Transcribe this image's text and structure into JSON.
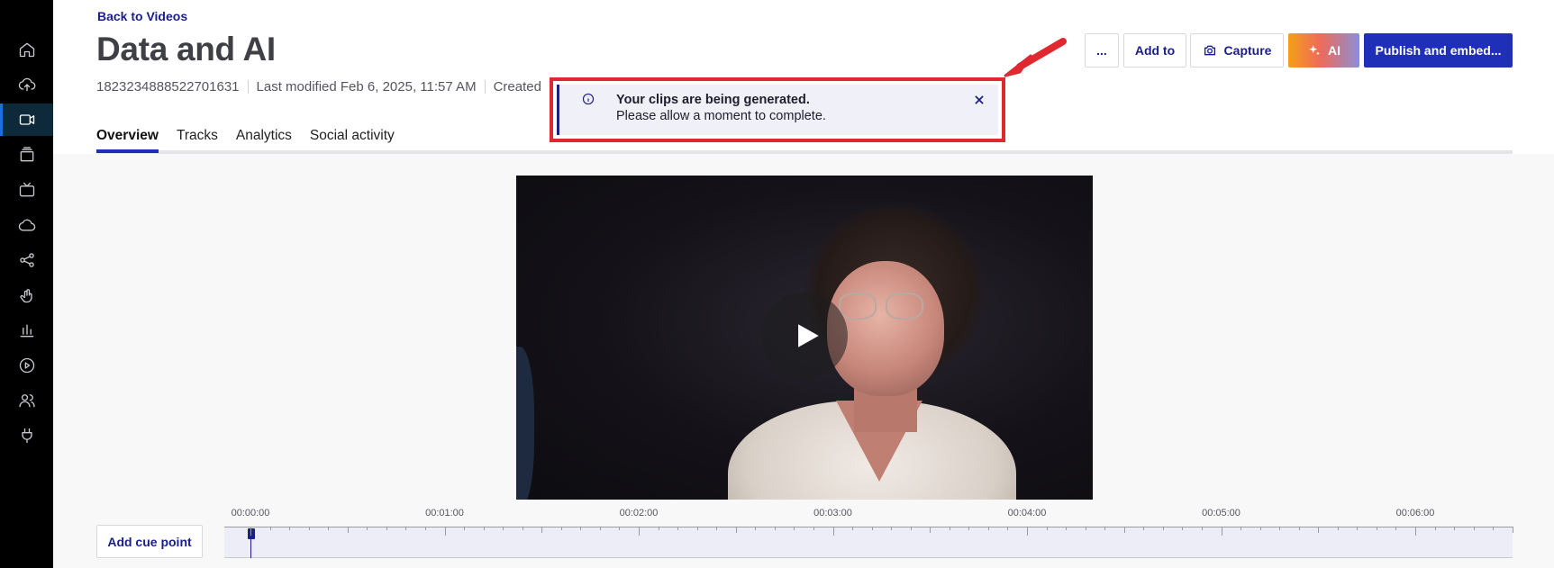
{
  "sidebar": {
    "items": [
      {
        "icon": "home-icon",
        "key": "home"
      },
      {
        "icon": "upload-cloud-icon",
        "key": "upload"
      },
      {
        "icon": "video-camera-icon",
        "key": "videos",
        "active": true
      },
      {
        "icon": "folders-icon",
        "key": "folders"
      },
      {
        "icon": "tv-icon",
        "key": "channels"
      },
      {
        "icon": "cloud-icon",
        "key": "cloud"
      },
      {
        "icon": "share-icon",
        "key": "share"
      },
      {
        "icon": "hand-icon",
        "key": "engage"
      },
      {
        "icon": "bar-chart-icon",
        "key": "analytics"
      },
      {
        "icon": "play-circle-icon",
        "key": "players"
      },
      {
        "icon": "users-icon",
        "key": "users"
      },
      {
        "icon": "plug-icon",
        "key": "integrations"
      }
    ]
  },
  "header": {
    "back_link": "Back to Videos",
    "title": "Data and AI",
    "video_id": "1823234888522701631",
    "last_modified": "Last modified Feb 6, 2025, 11:57 AM",
    "created_truncated": "Created"
  },
  "tabs": [
    "Overview",
    "Tracks",
    "Analytics",
    "Social activity"
  ],
  "toolbar": {
    "more_label": "...",
    "add_to_label": "Add to",
    "capture_label": "Capture",
    "ai_label": "AI",
    "publish_label": "Publish and embed..."
  },
  "toast": {
    "title": "Your clips are being generated.",
    "message": "Please allow a moment to complete."
  },
  "timeline": {
    "add_cue_label": "Add cue point",
    "labels": [
      "00:00:00",
      "00:01:00",
      "00:02:00",
      "00:03:00",
      "00:04:00",
      "00:05:00",
      "00:06:00"
    ],
    "playhead_position": "00:00:00"
  },
  "colors": {
    "accent": "#1f2fb8",
    "link": "#1a1f8c",
    "highlight": "#e02830",
    "sidebar_bg": "#000000"
  }
}
